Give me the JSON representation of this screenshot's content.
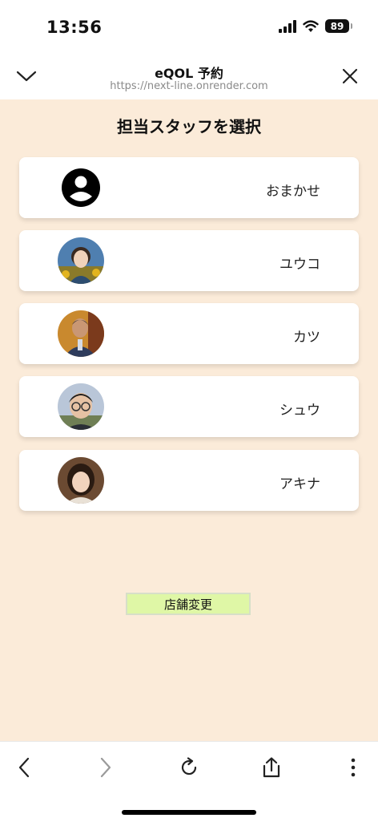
{
  "status_bar": {
    "time": "13:56",
    "battery": "89"
  },
  "browser": {
    "title": "eQOL 予約",
    "url": "https://next-line.onrender.com"
  },
  "page": {
    "heading": "担当スタッフを選択",
    "staff": [
      {
        "name": "おまかせ",
        "avatar": "generic-person-icon"
      },
      {
        "name": "ユウコ",
        "avatar": "photo"
      },
      {
        "name": "カツ",
        "avatar": "photo"
      },
      {
        "name": "シュウ",
        "avatar": "photo"
      },
      {
        "name": "アキナ",
        "avatar": "photo"
      }
    ],
    "change_store_label": "店舗変更"
  },
  "colors": {
    "page_background": "#fbebd9",
    "button_background": "#dff7a6",
    "card_background": "#ffffff"
  }
}
